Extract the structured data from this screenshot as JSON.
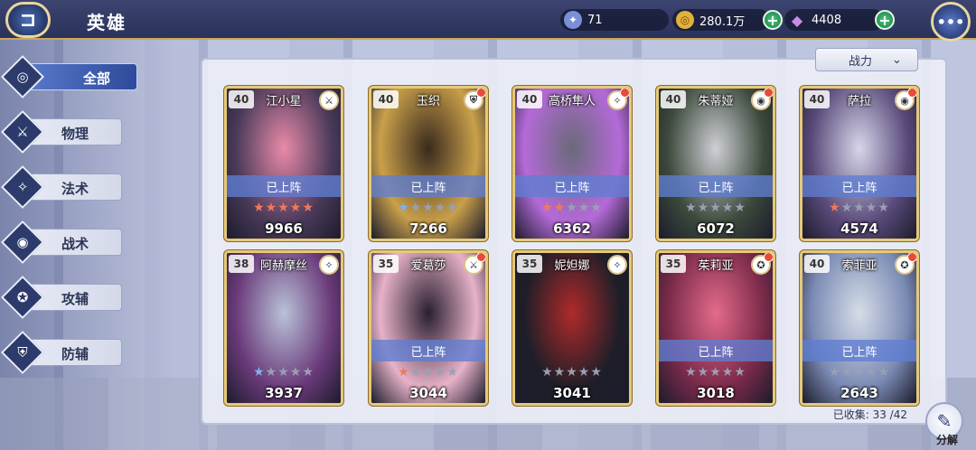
{
  "header": {
    "title": "英雄",
    "energy": "71",
    "gold": "280.1万",
    "gems": "4408"
  },
  "sidebar": {
    "items": [
      {
        "label": "全部",
        "icon": "all-icon",
        "active": true
      },
      {
        "label": "物理",
        "icon": "physical-icon",
        "active": false
      },
      {
        "label": "法术",
        "icon": "magic-icon",
        "active": false
      },
      {
        "label": "战术",
        "icon": "tactics-icon",
        "active": false
      },
      {
        "label": "攻辅",
        "icon": "attack-support-icon",
        "active": false
      },
      {
        "label": "防辅",
        "icon": "defense-support-icon",
        "active": false
      }
    ]
  },
  "sort": {
    "label": "战力"
  },
  "deployed_label": "已上阵",
  "heroes": [
    {
      "name": "江小星",
      "level": "40",
      "power": "9966",
      "stars": 5,
      "deployed": true,
      "badge": false,
      "class_icon": "physical-icon",
      "colors": [
        "#e98aa8",
        "#4a3a5a"
      ]
    },
    {
      "name": "玉织",
      "level": "40",
      "power": "7266",
      "stars": 1,
      "deployed": true,
      "badge": true,
      "class_icon": "defense-support-icon",
      "colors": [
        "#3a2a1e",
        "#c9a04a"
      ]
    },
    {
      "name": "高桥隼人",
      "level": "40",
      "power": "6362",
      "stars": 2,
      "deployed": true,
      "badge": true,
      "class_icon": "magic-icon",
      "colors": [
        "#6a6a7a",
        "#b46ad8"
      ]
    },
    {
      "name": "朱蒂娅",
      "level": "40",
      "power": "6072",
      "stars": 0,
      "deployed": true,
      "badge": true,
      "class_icon": "tactics-icon",
      "colors": [
        "#cfcfd6",
        "#3c4a3c"
      ]
    },
    {
      "name": "萨拉",
      "level": "40",
      "power": "4574",
      "stars": 1,
      "deployed": true,
      "badge": true,
      "class_icon": "tactics-icon",
      "colors": [
        "#d7d6ea",
        "#5a4a7a"
      ]
    },
    {
      "name": "阿赫摩丝",
      "level": "38",
      "power": "3937",
      "stars": 1,
      "deployed": false,
      "badge": false,
      "class_icon": "magic-icon",
      "colors": [
        "#b9c2d8",
        "#6a3a7a"
      ]
    },
    {
      "name": "爱葛莎",
      "level": "35",
      "power": "3044",
      "stars": 1,
      "deployed": true,
      "badge": true,
      "class_icon": "physical-icon",
      "colors": [
        "#2a2030",
        "#e7b2c8"
      ]
    },
    {
      "name": "妮妲娜",
      "level": "35",
      "power": "3041",
      "stars": 0,
      "deployed": false,
      "badge": false,
      "class_icon": "magic-icon",
      "colors": [
        "#b02a2a",
        "#1e1e28"
      ]
    },
    {
      "name": "茱莉亚",
      "level": "35",
      "power": "3018",
      "stars": 0,
      "deployed": true,
      "badge": true,
      "class_icon": "attack-support-icon",
      "colors": [
        "#e46a8a",
        "#7a2a4a"
      ]
    },
    {
      "name": "索菲亚",
      "level": "40",
      "power": "2643",
      "stars": 0,
      "deployed": true,
      "badge": true,
      "class_icon": "attack-support-icon",
      "colors": [
        "#d6dde8",
        "#7a8ab4"
      ]
    }
  ],
  "footer": {
    "collected_label": "已收集:",
    "collected_value": "33 /42",
    "dismantle_label": "分解"
  }
}
